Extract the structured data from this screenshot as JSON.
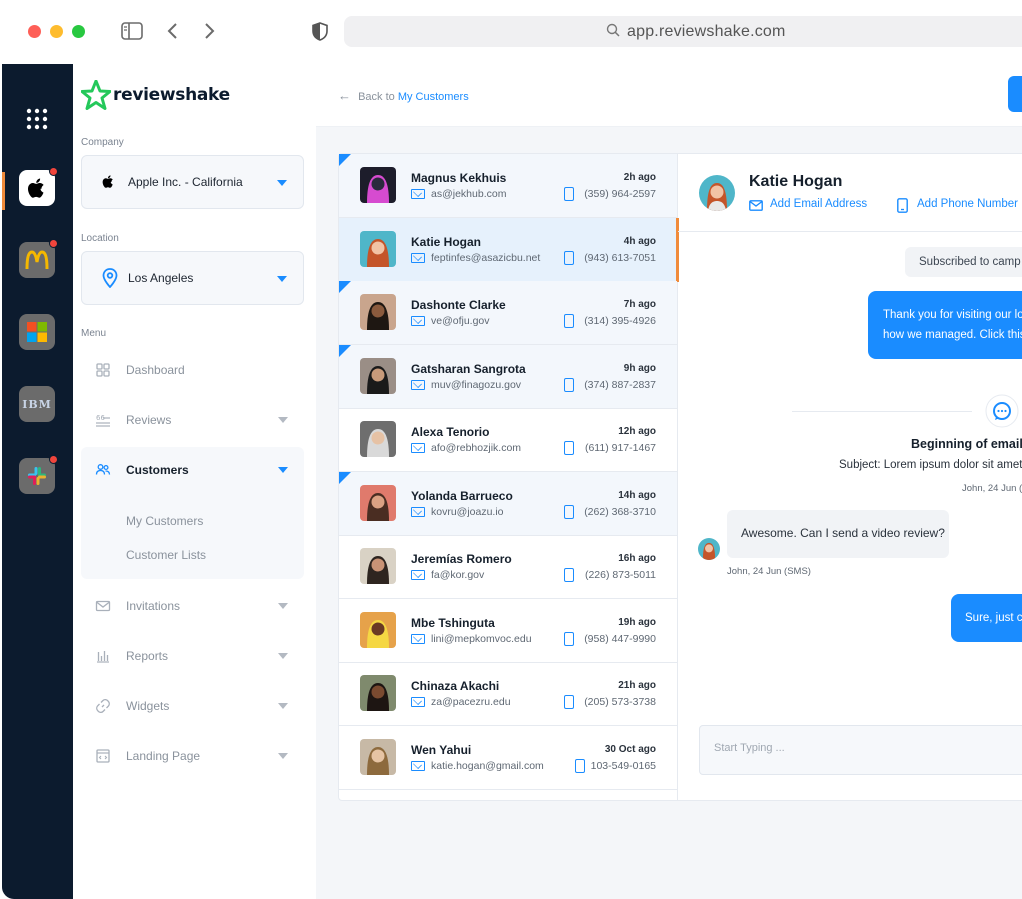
{
  "browser": {
    "url": "app.reviewshake.com"
  },
  "brand": {
    "name": "reviewshake",
    "accent": "#1a8cff",
    "rail_color": "#0c1b2e",
    "highlight": "#f08b3b"
  },
  "rail": {
    "apps": [
      {
        "name": "apple-app-icon",
        "badge": true
      },
      {
        "name": "mcdonalds-app-icon",
        "badge": true
      },
      {
        "name": "microsoft-app-icon",
        "badge": false
      },
      {
        "name": "ibm-app-icon",
        "badge": false,
        "text": "IBM"
      },
      {
        "name": "slack-app-icon",
        "badge": true
      }
    ]
  },
  "sidebar": {
    "company_label": "Company",
    "company_value": "Apple Inc. - California",
    "location_label": "Location",
    "location_value": "Los Angeles",
    "menu_label": "Menu",
    "items": [
      {
        "label": "Dashboard"
      },
      {
        "label": "Reviews"
      },
      {
        "label": "Customers"
      },
      {
        "label": "Invitations"
      },
      {
        "label": "Reports"
      },
      {
        "label": "Widgets"
      },
      {
        "label": "Landing Page"
      }
    ],
    "customers_sub": [
      {
        "label": "My Customers"
      },
      {
        "label": "Customer Lists"
      }
    ]
  },
  "topbar": {
    "back_prefix": "Back to",
    "back_link": "My Customers"
  },
  "customers": [
    {
      "name": "Magnus Kekhuis",
      "email": "as@jekhub.com",
      "time": "2h ago",
      "phone": "(359) 964-2597",
      "unread": true,
      "selected": false
    },
    {
      "name": "Katie Hogan",
      "email": "feptinfes@asazicbu.net",
      "time": "4h ago",
      "phone": "(943) 613-7051",
      "unread": false,
      "selected": true
    },
    {
      "name": "Dashonte Clarke",
      "email": "ve@ofju.gov",
      "time": "7h ago",
      "phone": "(314) 395-4926",
      "unread": true,
      "selected": false
    },
    {
      "name": "Gatsharan Sangrota",
      "email": "muv@finagozu.gov",
      "time": "9h ago",
      "phone": "(374) 887-2837",
      "unread": true,
      "selected": false
    },
    {
      "name": "Alexa Tenorio",
      "email": "afo@rebhozjik.com",
      "time": "12h ago",
      "phone": "(611) 917-1467",
      "unread": false,
      "selected": false
    },
    {
      "name": "Yolanda Barrueco",
      "email": "kovru@joazu.io",
      "time": "14h ago",
      "phone": "(262) 368-3710",
      "unread": true,
      "selected": false
    },
    {
      "name": "Jeremías Romero",
      "email": "fa@kor.gov",
      "time": "16h ago",
      "phone": "(226) 873-5011",
      "unread": false,
      "selected": false
    },
    {
      "name": "Mbe Tshinguta",
      "email": "lini@mepkomvoc.edu",
      "time": "19h ago",
      "phone": "(958) 447-9990",
      "unread": false,
      "selected": false
    },
    {
      "name": "Chinaza Akachi",
      "email": "za@pacezru.edu",
      "time": "21h ago",
      "phone": "(205) 573-3738",
      "unread": false,
      "selected": false
    },
    {
      "name": "Wen Yahui",
      "email": "katie.hogan@gmail.com",
      "time": "30 Oct ago",
      "phone": "103-549-0165",
      "unread": false,
      "selected": false
    }
  ],
  "conversation": {
    "name": "Katie Hogan",
    "add_email": "Add Email Address",
    "add_phone": "Add Phone Number",
    "subscribed": "Subscribed to camp",
    "msg_out_1_line1": "Thank you for visiting our lo",
    "msg_out_1_line2": "how we managed. Click this",
    "beginning": "Beginning of email c",
    "subject": "Subject: Lorem ipsum dolor sit amet",
    "email_meta": "John, 24 Jun (",
    "msg_in": "Awesome. Can I send a video review?",
    "msg_in_meta": "John, 24 Jun (SMS)",
    "msg_out_2": "Sure, just cl",
    "input_placeholder": "Start Typing ..."
  }
}
